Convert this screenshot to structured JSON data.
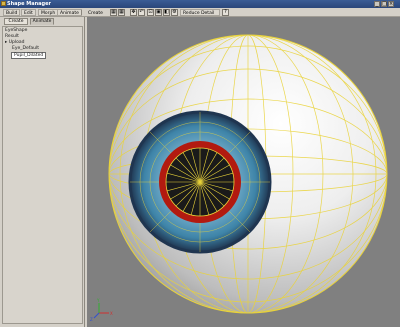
{
  "window": {
    "title": "Shape Manager",
    "controls": [
      "_",
      "□",
      "×"
    ]
  },
  "toolbar": {
    "build_label": "Build",
    "edit_label": "Edit",
    "morph_label": "Morph",
    "animate_label": "Animate",
    "create_label": "Create",
    "dropdown_label": "Reduce Detail",
    "help_label": "?"
  },
  "panel": {
    "tabs": [
      {
        "label": "Create"
      },
      {
        "label": "Animate"
      }
    ],
    "tree": [
      {
        "label": "EyeShape"
      },
      {
        "label": "Result"
      },
      {
        "label": "Upload"
      },
      {
        "label": "Eye_Default"
      },
      {
        "label": "Pupil_Dilated"
      }
    ]
  },
  "viewport": {
    "axis": {
      "x": "X",
      "y": "Y",
      "z": "Z"
    },
    "colors": {
      "background": "#808080",
      "sclera": "#f2f2f2",
      "iris": "#3e84a8",
      "limbal_ring": "#1f3550",
      "pupil_ring": "#b21a10",
      "pupil": "#1a1a1a",
      "wireframe": "#e9d33a"
    }
  }
}
